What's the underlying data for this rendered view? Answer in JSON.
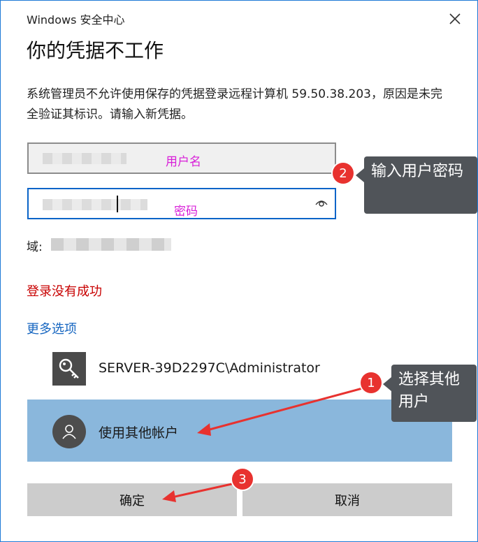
{
  "window": {
    "app_title": "Windows 安全中心",
    "close_icon": "close-icon"
  },
  "heading": "你的凭据不工作",
  "message": "系统管理员不允许使用保存的凭据登录远程计算机 59.50.38.203，原因是未完全验证其标识。请输入新凭据。",
  "fields": {
    "username_annotation": "用户名",
    "password_annotation": "密码",
    "reveal_icon": "eye-icon"
  },
  "domain_label": "域:",
  "error_text": "登录没有成功",
  "more_options": "更多选项",
  "accounts": [
    {
      "label": "SERVER-39D2297C\\Administrator",
      "icon": "key-icon"
    },
    {
      "label": "使用其他帐户",
      "icon": "user-icon",
      "selected": true
    }
  ],
  "buttons": {
    "ok": "确定",
    "cancel": "取消"
  },
  "annotations": {
    "step1_number": "1",
    "step1_text": "选择其他用户",
    "step2_number": "2",
    "step2_text": "输入用户密码",
    "step3_number": "3"
  },
  "colors": {
    "accent": "#0a64c8",
    "selected_bg": "#8ab7dc",
    "error": "#c80000",
    "link": "#1565c0",
    "badge": "#e8322f"
  }
}
